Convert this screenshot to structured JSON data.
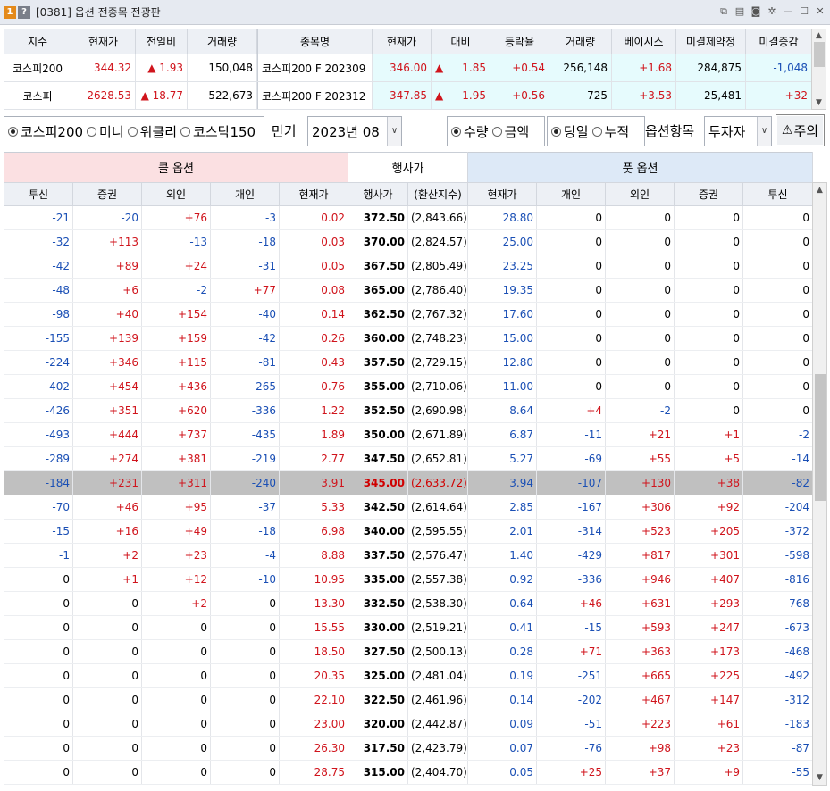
{
  "window": {
    "badge_num": "1",
    "badge_help": "?",
    "title": "[0381] 옵션 전종목 전광판"
  },
  "index_table": {
    "headers": [
      "지수",
      "현재가",
      "전일비",
      "거래량"
    ],
    "rows": [
      {
        "name": "코스피200",
        "price": "344.32",
        "change_arrow": "▲",
        "change": "1.93",
        "volume": "150,048"
      },
      {
        "name": "코스피",
        "price": "2628.53",
        "change_arrow": "▲",
        "change": "18.77",
        "volume": "522,673"
      }
    ]
  },
  "futures_table": {
    "headers": [
      "종목명",
      "현재가",
      "대비",
      "등락율",
      "거래량",
      "베이시스",
      "미결제약정",
      "미결증감"
    ],
    "rows": [
      {
        "name": "코스피200 F 202309",
        "price": "346.00",
        "arrow": "▲",
        "change": "1.85",
        "rate": "+0.54",
        "volume": "256,148",
        "basis": "+1.68",
        "oi": "284,875",
        "oi_change": "-1,048"
      },
      {
        "name": "코스피200 F 202312",
        "price": "347.85",
        "arrow": "▲",
        "change": "1.95",
        "rate": "+0.56",
        "volume": "725",
        "basis": "+3.53",
        "oi": "25,481",
        "oi_change": "+32"
      }
    ]
  },
  "controls": {
    "market_options": [
      "코스피200",
      "미니",
      "위클리",
      "코스닥150"
    ],
    "market_selected": 0,
    "expiry_label": "만기",
    "expiry_value": "2023년 08",
    "unit_options": [
      "수량",
      "금액"
    ],
    "unit_selected": 0,
    "period_options": [
      "당일",
      "누적"
    ],
    "period_selected": 0,
    "option_item_label": "옵션항목",
    "investor_value": "투자자",
    "warning_label": "주의"
  },
  "board": {
    "call_title": "콜 옵션",
    "strike_title": "행사가",
    "put_title": "풋 옵션",
    "headers": [
      "투신",
      "증권",
      "외인",
      "개인",
      "현재가",
      "행사가",
      "(환산지수)",
      "현재가",
      "개인",
      "외인",
      "증권",
      "투신"
    ],
    "atm_strike": "345.00",
    "rows": [
      [
        "-21",
        "-20",
        "+76",
        "-3",
        "0.02",
        "372.50",
        "(2,843.66)",
        "28.80",
        "0",
        "0",
        "0",
        "0"
      ],
      [
        "-32",
        "+113",
        "-13",
        "-18",
        "0.03",
        "370.00",
        "(2,824.57)",
        "25.00",
        "0",
        "0",
        "0",
        "0"
      ],
      [
        "-42",
        "+89",
        "+24",
        "-31",
        "0.05",
        "367.50",
        "(2,805.49)",
        "23.25",
        "0",
        "0",
        "0",
        "0"
      ],
      [
        "-48",
        "+6",
        "-2",
        "+77",
        "0.08",
        "365.00",
        "(2,786.40)",
        "19.35",
        "0",
        "0",
        "0",
        "0"
      ],
      [
        "-98",
        "+40",
        "+154",
        "-40",
        "0.14",
        "362.50",
        "(2,767.32)",
        "17.60",
        "0",
        "0",
        "0",
        "0"
      ],
      [
        "-155",
        "+139",
        "+159",
        "-42",
        "0.26",
        "360.00",
        "(2,748.23)",
        "15.00",
        "0",
        "0",
        "0",
        "0"
      ],
      [
        "-224",
        "+346",
        "+115",
        "-81",
        "0.43",
        "357.50",
        "(2,729.15)",
        "12.80",
        "0",
        "0",
        "0",
        "0"
      ],
      [
        "-402",
        "+454",
        "+436",
        "-265",
        "0.76",
        "355.00",
        "(2,710.06)",
        "11.00",
        "0",
        "0",
        "0",
        "0"
      ],
      [
        "-426",
        "+351",
        "+620",
        "-336",
        "1.22",
        "352.50",
        "(2,690.98)",
        "8.64",
        "+4",
        "-2",
        "0",
        "0"
      ],
      [
        "-493",
        "+444",
        "+737",
        "-435",
        "1.89",
        "350.00",
        "(2,671.89)",
        "6.87",
        "-11",
        "+21",
        "+1",
        "-2"
      ],
      [
        "-289",
        "+274",
        "+381",
        "-219",
        "2.77",
        "347.50",
        "(2,652.81)",
        "5.27",
        "-69",
        "+55",
        "+5",
        "-14"
      ],
      [
        "-184",
        "+231",
        "+311",
        "-240",
        "3.91",
        "345.00",
        "(2,633.72)",
        "3.94",
        "-107",
        "+130",
        "+38",
        "-82"
      ],
      [
        "-70",
        "+46",
        "+95",
        "-37",
        "5.33",
        "342.50",
        "(2,614.64)",
        "2.85",
        "-167",
        "+306",
        "+92",
        "-204"
      ],
      [
        "-15",
        "+16",
        "+49",
        "-18",
        "6.98",
        "340.00",
        "(2,595.55)",
        "2.01",
        "-314",
        "+523",
        "+205",
        "-372"
      ],
      [
        "-1",
        "+2",
        "+23",
        "-4",
        "8.88",
        "337.50",
        "(2,576.47)",
        "1.40",
        "-429",
        "+817",
        "+301",
        "-598"
      ],
      [
        "0",
        "+1",
        "+12",
        "-10",
        "10.95",
        "335.00",
        "(2,557.38)",
        "0.92",
        "-336",
        "+946",
        "+407",
        "-816"
      ],
      [
        "0",
        "0",
        "+2",
        "0",
        "13.30",
        "332.50",
        "(2,538.30)",
        "0.64",
        "+46",
        "+631",
        "+293",
        "-768"
      ],
      [
        "0",
        "0",
        "0",
        "0",
        "15.55",
        "330.00",
        "(2,519.21)",
        "0.41",
        "-15",
        "+593",
        "+247",
        "-673"
      ],
      [
        "0",
        "0",
        "0",
        "0",
        "18.50",
        "327.50",
        "(2,500.13)",
        "0.28",
        "+71",
        "+363",
        "+173",
        "-468"
      ],
      [
        "0",
        "0",
        "0",
        "0",
        "20.35",
        "325.00",
        "(2,481.04)",
        "0.19",
        "-251",
        "+665",
        "+225",
        "-492"
      ],
      [
        "0",
        "0",
        "0",
        "0",
        "22.10",
        "322.50",
        "(2,461.96)",
        "0.14",
        "-202",
        "+467",
        "+147",
        "-312"
      ],
      [
        "0",
        "0",
        "0",
        "0",
        "23.00",
        "320.00",
        "(2,442.87)",
        "0.09",
        "-51",
        "+223",
        "+61",
        "-183"
      ],
      [
        "0",
        "0",
        "0",
        "0",
        "26.30",
        "317.50",
        "(2,423.79)",
        "0.07",
        "-76",
        "+98",
        "+23",
        "-87"
      ],
      [
        "0",
        "0",
        "0",
        "0",
        "28.75",
        "315.00",
        "(2,404.70)",
        "0.05",
        "+25",
        "+37",
        "+9",
        "-55"
      ]
    ]
  },
  "colors": {
    "up": "#d0141c",
    "down": "#1a4fb5",
    "call_header_bg": "#fbe0e2",
    "put_header_bg": "#dde9f7",
    "futures_cell_bg": "#e6fbfd",
    "atm_row_bg": "#c0c0c0"
  },
  "icons": [
    "link-icon",
    "copy-icon",
    "camera-icon",
    "settings-icon",
    "minimize-icon",
    "maximize-icon",
    "close-icon",
    "warning-icon"
  ]
}
